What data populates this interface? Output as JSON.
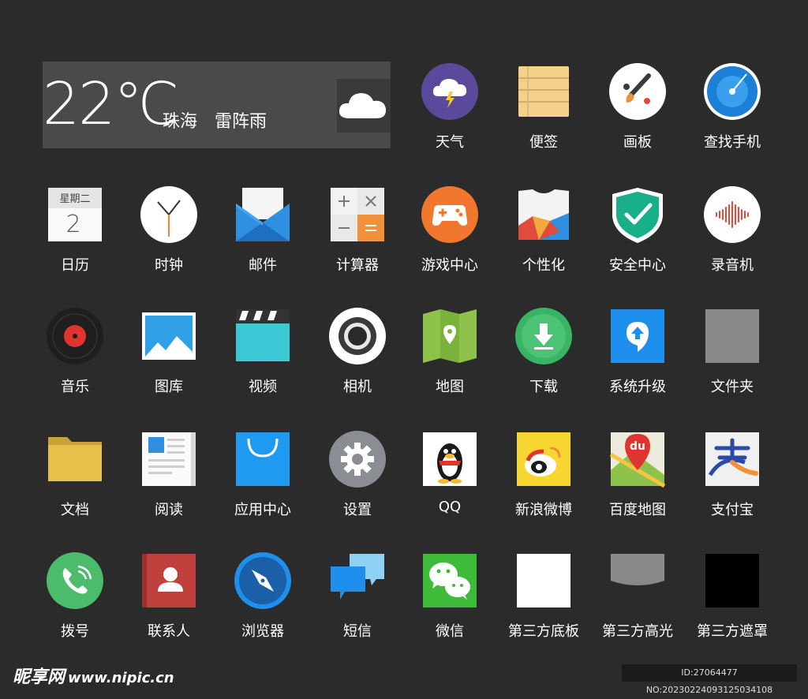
{
  "weather": {
    "temperature": "22℃",
    "city": "珠海",
    "condition": "雷阵雨"
  },
  "apps": {
    "weather": "天气",
    "notes": "便签",
    "paint": "画板",
    "find_phone": "查找手机",
    "calendar": "日历",
    "clock": "时钟",
    "mail": "邮件",
    "calculator": "计算器",
    "game_center": "游戏中心",
    "theme": "个性化",
    "security": "安全中心",
    "recorder": "录音机",
    "music": "音乐",
    "gallery": "图库",
    "video": "视频",
    "camera": "相机",
    "maps": "地图",
    "download": "下载",
    "system_update": "系统升级",
    "files": "文件夹",
    "documents": "文档",
    "reader": "阅读",
    "app_store": "应用中心",
    "settings": "设置",
    "qq": "QQ",
    "weibo": "新浪微博",
    "baidu_map": "百度地图",
    "alipay": "支付宝",
    "dialer": "拨号",
    "contacts": "联系人",
    "browser": "浏览器",
    "sms": "短信",
    "wechat": "微信",
    "third_base": "第三方底板",
    "third_highlight": "第三方高光",
    "third_mask": "第三方遮罩"
  },
  "calendar_icon": {
    "weekday": "星期二",
    "day": "2"
  },
  "baidu_icon": {
    "text": "du"
  },
  "footer": {
    "brand": "昵享网",
    "url": "www.nipic.cn",
    "id_text": "ID:27064477 NO:20230224093125034108"
  }
}
